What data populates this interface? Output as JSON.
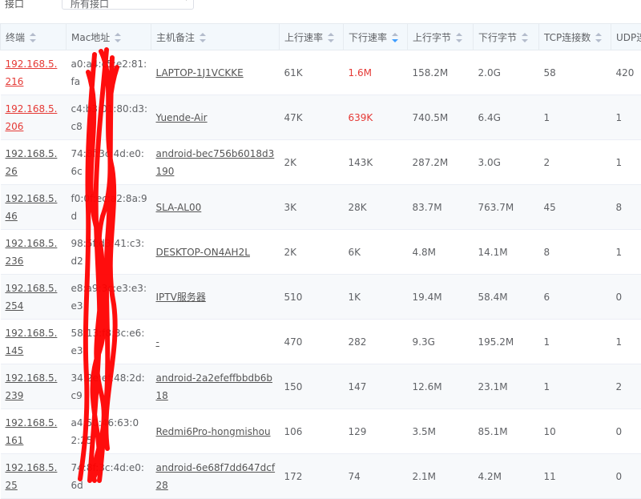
{
  "filter": {
    "label": "接口",
    "value": "所有接口"
  },
  "columns": [
    {
      "key": "ip",
      "label": "终端",
      "sort": ""
    },
    {
      "key": "mac",
      "label": "Mac地址",
      "sort": ""
    },
    {
      "key": "host",
      "label": "主机备注",
      "sort": ""
    },
    {
      "key": "up_rate",
      "label": "上行速率",
      "sort": ""
    },
    {
      "key": "down_rate",
      "label": "下行速率",
      "sort": "desc"
    },
    {
      "key": "up_bytes",
      "label": "上行字节",
      "sort": ""
    },
    {
      "key": "down_bytes",
      "label": "下行字节",
      "sort": ""
    },
    {
      "key": "tcp",
      "label": "TCP连接数",
      "sort": ""
    },
    {
      "key": "udp",
      "label": "UDP连",
      "sort": ""
    }
  ],
  "rows": [
    {
      "ip": "192.168.5.216",
      "mac": "a0:a4:c5:e2:81:fa",
      "host": "LAPTOP-1J1VCKKE",
      "up_rate": "61K",
      "down_rate": "1.6M",
      "up_bytes": "158.2M",
      "down_bytes": "2.0G",
      "tcp": "58",
      "udp": "420",
      "highlight": true
    },
    {
      "ip": "192.168.5.206",
      "mac": "c4:b3:01:80:d3:c8",
      "host": "Yuende-Air",
      "up_rate": "47K",
      "down_rate": "639K",
      "up_bytes": "740.5M",
      "down_bytes": "6.4G",
      "tcp": "1",
      "udp": "1",
      "highlight": true
    },
    {
      "ip": "192.168.5.26",
      "mac": "74:8f:3c:4d:e0:6c",
      "host": "android-bec756b6018d3190",
      "up_rate": "2K",
      "down_rate": "143K",
      "up_bytes": "287.2M",
      "down_bytes": "3.0G",
      "tcp": "2",
      "udp": "1",
      "highlight": false
    },
    {
      "ip": "192.168.5.46",
      "mac": "f0:0f:ec:a2:8a:9d",
      "host": "SLA-AL00",
      "up_rate": "3K",
      "down_rate": "28K",
      "up_bytes": "83.7M",
      "down_bytes": "763.7M",
      "tcp": "45",
      "udp": "8",
      "highlight": false
    },
    {
      "ip": "192.168.5.236",
      "mac": "98:5f:d3:41:c3:d2",
      "host": "DESKTOP-ON4AH2L",
      "up_rate": "2K",
      "down_rate": "6K",
      "up_bytes": "4.8M",
      "down_bytes": "14.1M",
      "tcp": "8",
      "udp": "1",
      "highlight": false
    },
    {
      "ip": "192.168.5.254",
      "mac": "e8:a9:3c:e3:e3:e3",
      "host": "IPTV服务器",
      "up_rate": "510",
      "down_rate": "1K",
      "up_bytes": "19.4M",
      "down_bytes": "58.4M",
      "tcp": "6",
      "udp": "0",
      "highlight": false
    },
    {
      "ip": "192.168.5.145",
      "mac": "58:13:f8:3c:e6:e3",
      "host": "-",
      "up_rate": "470",
      "down_rate": "282",
      "up_bytes": "9.3G",
      "down_bytes": "195.2M",
      "tcp": "1",
      "udp": "1",
      "highlight": false
    },
    {
      "ip": "192.168.5.239",
      "mac": "34:2e:ef:48:2d:c9",
      "host": "android-2a2efeffbbdb6b18",
      "up_rate": "150",
      "down_rate": "147",
      "up_bytes": "12.6M",
      "down_bytes": "23.1M",
      "tcp": "1",
      "udp": "2",
      "highlight": false
    },
    {
      "ip": "192.168.5.161",
      "mac": "a4:50:46:63:02:25",
      "host": "Redmi6Pro-hongmishou",
      "up_rate": "106",
      "down_rate": "129",
      "up_bytes": "3.5M",
      "down_bytes": "85.1M",
      "tcp": "10",
      "udp": "0",
      "highlight": false
    },
    {
      "ip": "192.168.5.25",
      "mac": "74:8f:3c:4d:e0:6d",
      "host": "android-6e68f7dd647dcf28",
      "up_rate": "172",
      "down_rate": "74",
      "up_bytes": "2.1M",
      "down_bytes": "4.2M",
      "tcp": "11",
      "udp": "0",
      "highlight": false
    }
  ],
  "colors": {
    "alert": "#e53935",
    "scribble": "#ff0000",
    "header_bg": "#f3f8fc",
    "sort_active": "#409eff"
  }
}
